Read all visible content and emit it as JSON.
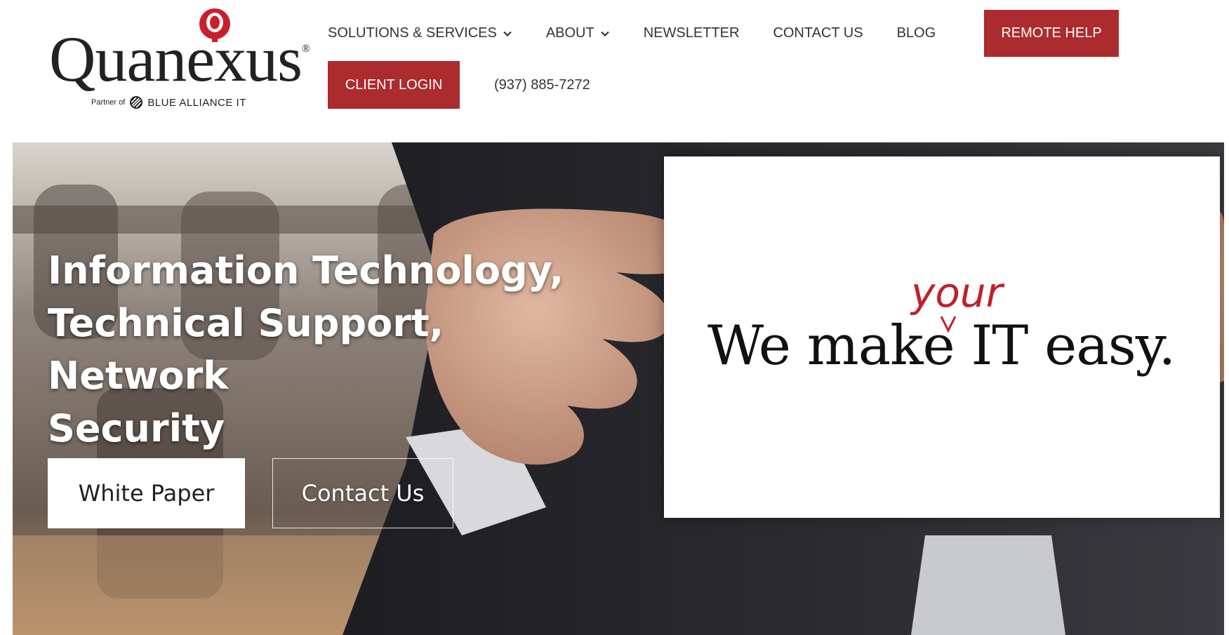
{
  "logo": {
    "wordmark": "Quanexus",
    "registered": "®",
    "partner_of": "Partner of",
    "partner_name": "BLUE ALLIANCE IT",
    "brand_color": "#c8202b"
  },
  "nav": {
    "items": [
      {
        "label": "SOLUTIONS & SERVICES",
        "has_dropdown": true,
        "icon": "chevron-down-icon"
      },
      {
        "label": "ABOUT",
        "has_dropdown": true,
        "icon": "chevron-down-icon"
      },
      {
        "label": "NEWSLETTER",
        "has_dropdown": false
      },
      {
        "label": "CONTACT US",
        "has_dropdown": false
      },
      {
        "label": "BLOG",
        "has_dropdown": false
      }
    ],
    "remote_help": "REMOTE HELP",
    "client_login": "CLIENT LOGIN",
    "phone": "(937) 885-7272",
    "accent_color": "#ab2b2e"
  },
  "hero": {
    "headline_lines": [
      "Information Technology,",
      "Technical Support, Network",
      "Security"
    ],
    "buttons": {
      "white_paper": "White Paper",
      "contact_us": "Contact Us"
    },
    "sign": {
      "text": "We make IT easy.",
      "inserted_word": "your",
      "inserted_word_color": "#c0202a"
    }
  }
}
